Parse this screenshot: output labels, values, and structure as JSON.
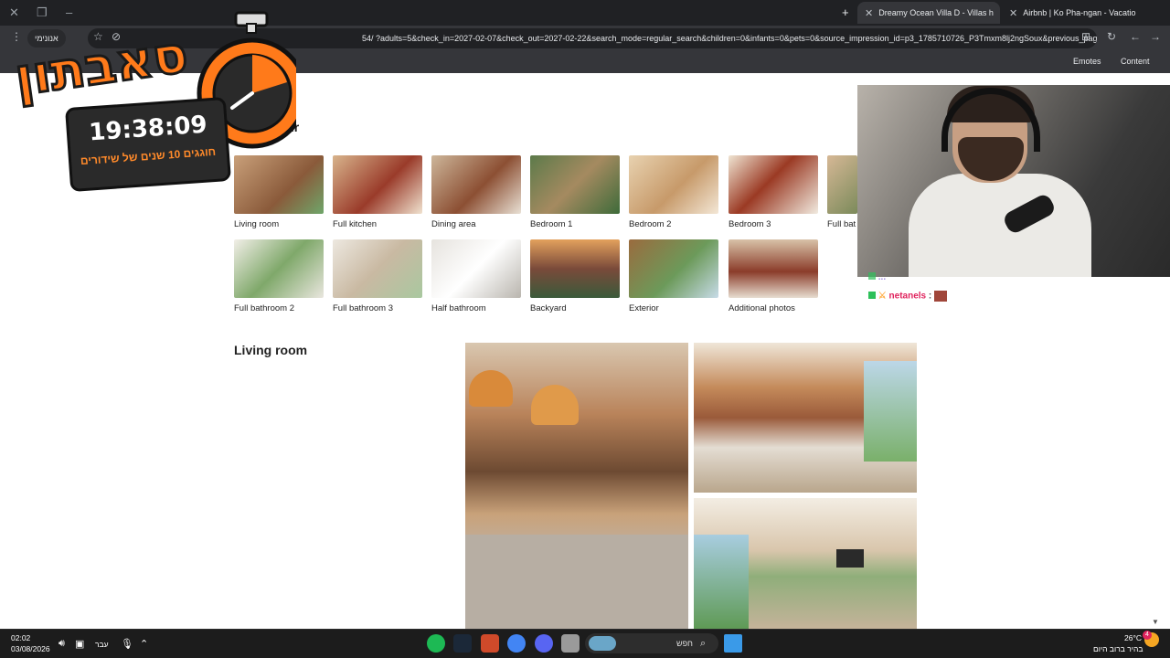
{
  "browser": {
    "tabs": [
      {
        "title": "Dreamy Ocean Villa D - Villas h",
        "active": true
      },
      {
        "title": "Airbnb | Ko Pha-ngan - Vacatio",
        "active": false
      }
    ],
    "new_tab_symbol": "+",
    "incognito_label": "אנונימי",
    "url": "airbnb.com/rooms/154...?adults=5&check_in=2027-02-07&check_out=2027-02-22&search_mode=regular_search&children=0&infants=0&pets=0&source_impression_id=p3_1785710726_P3Tmxm8lj2ngSoux&previous_page_sectio...",
    "url_visible": "54/ ?adults=5&check_in=2027-02-07&check_out=2027-02-22&search_mode=regular_search&children=0&infants=0&pets=0&source_impression_id=p3_1785710726_P3Tmxm8lj2ngSoux&previous_page_sectio...",
    "bookmarks": [
      "Emotes",
      "Content"
    ]
  },
  "page": {
    "tour_title": "tour",
    "thumbnails_row1": [
      "Living room",
      "Full kitchen",
      "Dining area",
      "Bedroom 1",
      "Bedroom 2",
      "Bedroom 3",
      "Full bat"
    ],
    "thumbnails_row2": [
      "Full bathroom 2",
      "Full bathroom 3",
      "Half bathroom",
      "Backyard",
      "Exterior",
      "Additional photos"
    ],
    "section_title": "Living room"
  },
  "overlay": {
    "brand": "סאבתון",
    "timer": "19:38:09",
    "subtitle": "חוגגים 10 שנים של שידורים"
  },
  "chat": {
    "line1_user": "...",
    "line2_user": "netanels",
    "line2_sep": ":"
  },
  "taskbar": {
    "time": "02:02",
    "date": "03/08/2026",
    "language": "עבר",
    "search_label": "חפש",
    "weather_temp": "26°C",
    "weather_desc": "בהיר ברוב היום",
    "notif_count": "4"
  },
  "colors": {
    "accent_brand": "#ff7a1a",
    "airbnb": "#ff385c",
    "chat_user2": "#e0245e"
  }
}
